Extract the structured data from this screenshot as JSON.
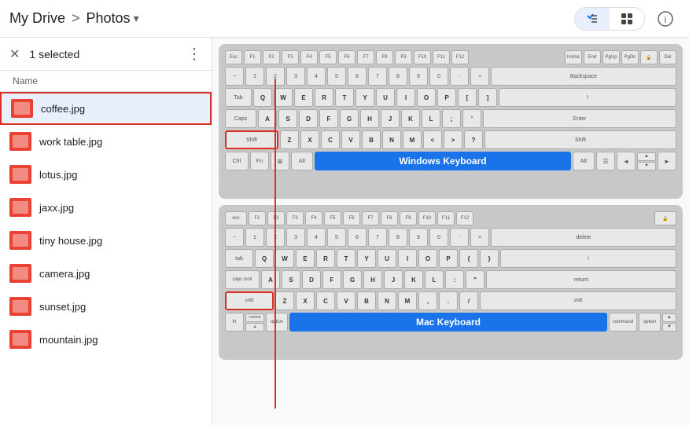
{
  "header": {
    "my_drive_label": "My Drive",
    "separator": ">",
    "photos_label": "Photos",
    "chevron": "▾",
    "list_view_icon": "☰",
    "grid_view_icon": "⊞",
    "info_icon": "ⓘ"
  },
  "selection_bar": {
    "close_icon": "✕",
    "count_label": "1 selected",
    "more_icon": "⋮"
  },
  "file_list": {
    "column_header": "Name",
    "files": [
      {
        "name": "coffee.jpg",
        "selected": true
      },
      {
        "name": "work table.jpg",
        "selected": false
      },
      {
        "name": "lotus.jpg",
        "selected": false
      },
      {
        "name": "jaxx.jpg",
        "selected": false
      },
      {
        "name": "tiny house.jpg",
        "selected": false
      },
      {
        "name": "camera.jpg",
        "selected": false
      },
      {
        "name": "sunset.jpg",
        "selected": false
      },
      {
        "name": "mountain.jpg",
        "selected": false
      }
    ]
  },
  "preview": {
    "windows_keyboard_label": "Windows Keyboard",
    "mac_keyboard_label": "Mac Keyboard"
  }
}
